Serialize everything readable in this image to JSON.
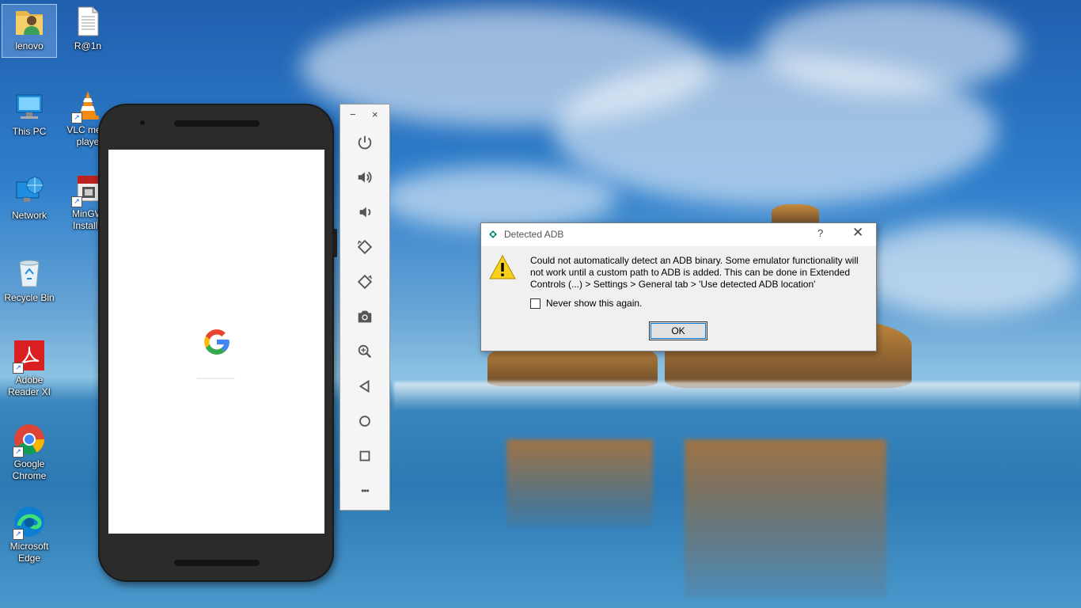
{
  "desktop": {
    "icons": [
      {
        "label": "lenovo"
      },
      {
        "label": "R@1n"
      },
      {
        "label": "This PC"
      },
      {
        "label": "VLC media player",
        "label_visible": "VLC me... playe"
      },
      {
        "label": "Network"
      },
      {
        "label": "MinGW Installer",
        "label_visible": "MinGW Installe"
      },
      {
        "label": "Recycle Bin"
      },
      {
        "label": "Adobe Reader XI"
      },
      {
        "label": "Google Chrome"
      },
      {
        "label": "Microsoft Edge"
      }
    ]
  },
  "emulator": {
    "toolbar": {
      "minimize": "−",
      "close": "×",
      "tools": [
        "power-icon",
        "volume-up-icon",
        "volume-down-icon",
        "rotate-left-icon",
        "rotate-right-icon",
        "camera-icon",
        "zoom-icon",
        "back-icon",
        "home-icon",
        "overview-icon",
        "more-icon"
      ],
      "more_label": "•••"
    }
  },
  "dialog": {
    "title": "Detected ADB",
    "help": "?",
    "close": "✕",
    "message": "Could not automatically detect an ADB binary. Some emulator functionality will not work until a custom path to ADB  is added. This can be done in Extended Controls (...) > Settings > General tab > 'Use detected ADB location'",
    "checkbox_label": "Never show this again.",
    "checkbox_checked": false,
    "ok_label": "OK"
  },
  "colors": {
    "google_blue": "#4285F4",
    "google_red": "#EA4335",
    "google_yellow": "#FBBC05",
    "google_green": "#34A853",
    "warning_yellow": "#F7D117"
  }
}
